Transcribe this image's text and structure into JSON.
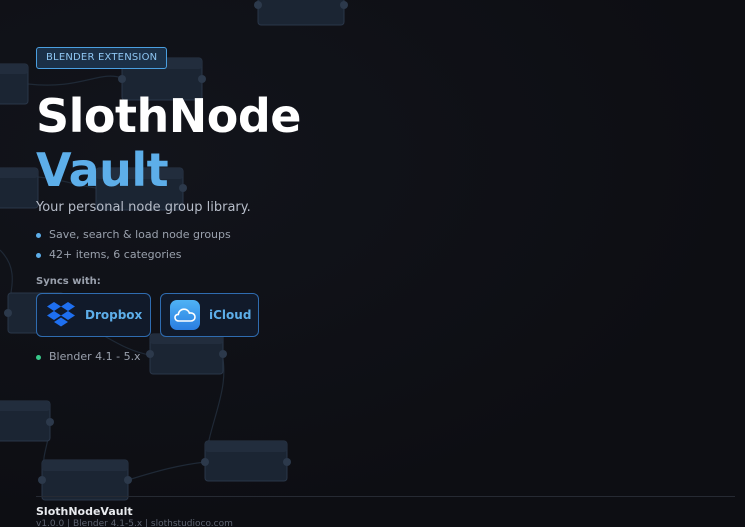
{
  "badge": "BLENDER EXTENSION",
  "title": {
    "line1": "SlothNode",
    "line2": "Vault"
  },
  "tagline": "Your personal node group library.",
  "features": [
    "Save, search & load node groups",
    "42+ items, 6 categories"
  ],
  "syncs": {
    "label": "Syncs with:",
    "services": [
      {
        "name": "Dropbox",
        "icon": "dropbox-icon",
        "color": "#1e6ff0"
      },
      {
        "name": "iCloud",
        "icon": "icloud-icon",
        "color": "#3a95ec"
      }
    ]
  },
  "compatibility": "Blender 4.1 - 5.x",
  "footer": {
    "title": "SlothNodeVault",
    "meta": "v1.0.0  |  Blender 4.1-5.x  |  slothstudioco.com"
  },
  "colors": {
    "accent": "#5daee9",
    "background": "#0e0f14",
    "status_green": "#38c98a"
  }
}
